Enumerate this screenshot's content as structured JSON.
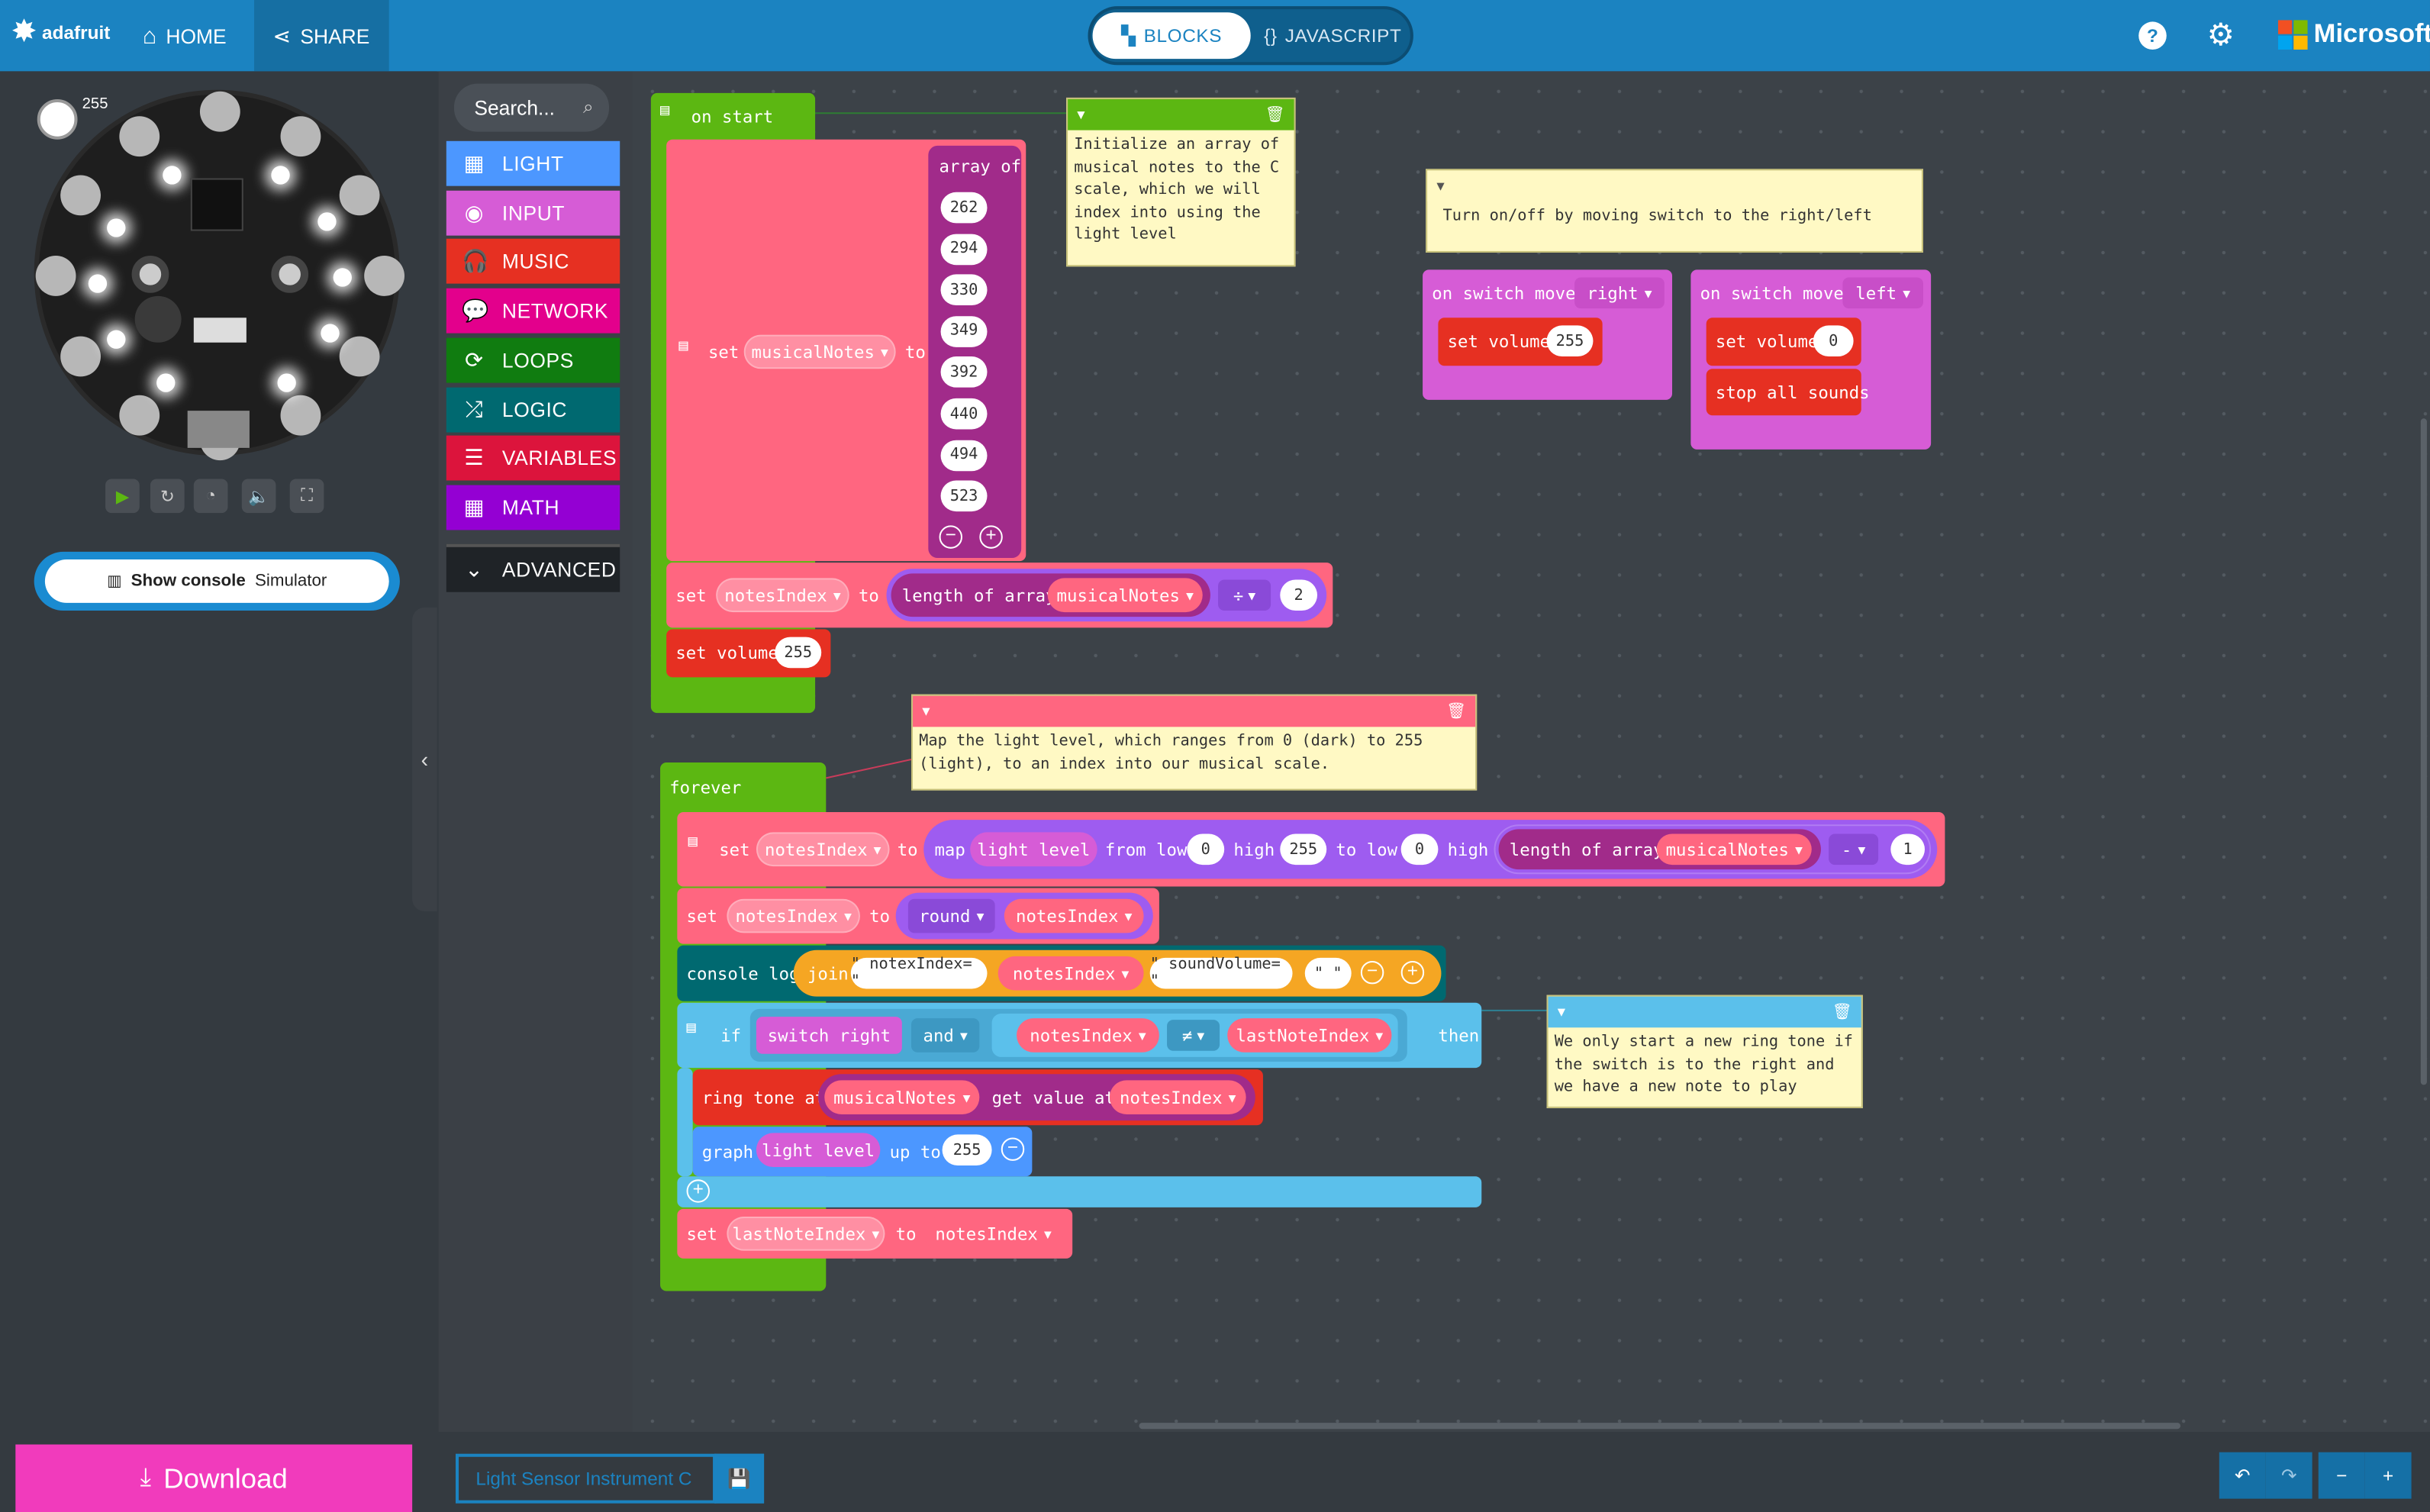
{
  "header": {
    "logo_text": "adafruit",
    "home_label": "HOME",
    "share_label": "SHARE",
    "blocks_label": "BLOCKS",
    "javascript_label": "JAVASCRIPT",
    "brand_label": "Microsoft"
  },
  "simulator": {
    "light_value": "255",
    "console_label": "Show console",
    "console_sub": "Simulator"
  },
  "toolbox": {
    "search_placeholder": "Search...",
    "categories": [
      {
        "label": "LIGHT",
        "color": "#4c97ff",
        "icon": "grid-icon"
      },
      {
        "label": "INPUT",
        "color": "#d65cd6",
        "icon": "target-icon"
      },
      {
        "label": "MUSIC",
        "color": "#e63022",
        "icon": "headphones-icon"
      },
      {
        "label": "NETWORK",
        "color": "#e3008c",
        "icon": "chat-icon"
      },
      {
        "label": "LOOPS",
        "color": "#107c10",
        "icon": "refresh-icon"
      },
      {
        "label": "LOGIC",
        "color": "#006970",
        "icon": "shuffle-icon"
      },
      {
        "label": "VARIABLES",
        "color": "#dc143c",
        "icon": "list-icon"
      },
      {
        "label": "MATH",
        "color": "#9400d3",
        "icon": "calculator-icon"
      },
      {
        "label": "ADVANCED",
        "color": "#3c3c3c",
        "icon": "chevron-down-icon"
      }
    ]
  },
  "colors": {
    "loops": "#5cb712",
    "variables": "#ff6680",
    "arrays": "#a12b8a",
    "math": "#9e5cf0",
    "music": "#e63022",
    "input": "#d65cd6",
    "logic": "#5bc0eb",
    "text": "#f5a623",
    "console": "#006970",
    "header": "#1b83c1",
    "download": "#f13bbc"
  },
  "blocks": {
    "on_start": "on start",
    "set": "set",
    "to": "to",
    "array_of": "array of",
    "musical_notes": "musicalNotes",
    "notes_index": "notesIndex",
    "last_note_index": "lastNoteIndex",
    "array_values": [
      "262",
      "294",
      "330",
      "349",
      "392",
      "440",
      "494",
      "523"
    ],
    "length_of_array": "length of array",
    "divide_op": "÷",
    "two": "2",
    "set_volume": "set volume",
    "vol_255": "255",
    "vol_0": "0",
    "forever": "forever",
    "map": "map",
    "light_level": "light level",
    "from_low": "from low",
    "high": "high",
    "to_low": "to low",
    "zero": "0",
    "minus_op": "-",
    "one": "1",
    "round": "round",
    "console_log": "console log",
    "join": "join",
    "str_notex": "\" notexIndex= \"",
    "str_sound": "\" soundVolume= \"",
    "str_space": "\"  \"",
    "if": "if",
    "switch_right": "switch right",
    "and": "and",
    "neq": "≠",
    "then": "then",
    "ring_tone_at": "ring tone at",
    "get_value_at": "get value at",
    "graph": "graph",
    "up_to": "up to",
    "on_switch_moved": "on switch moved",
    "right": "right",
    "left": "left",
    "stop_all_sounds": "stop all sounds"
  },
  "comments": {
    "c1": "Initialize an array of musical notes to the C scale, which we will index into using the light level",
    "c2": "Turn on/off by moving switch to the right/left",
    "c3": "Map the light level, which ranges from 0 (dark) to 255 (light), to an index into our musical scale.",
    "c4": "We only start a new ring tone if the switch is to the right and we have a new note to play"
  },
  "footer": {
    "download_label": "Download",
    "project_name": "Light Sensor Instrument C"
  }
}
